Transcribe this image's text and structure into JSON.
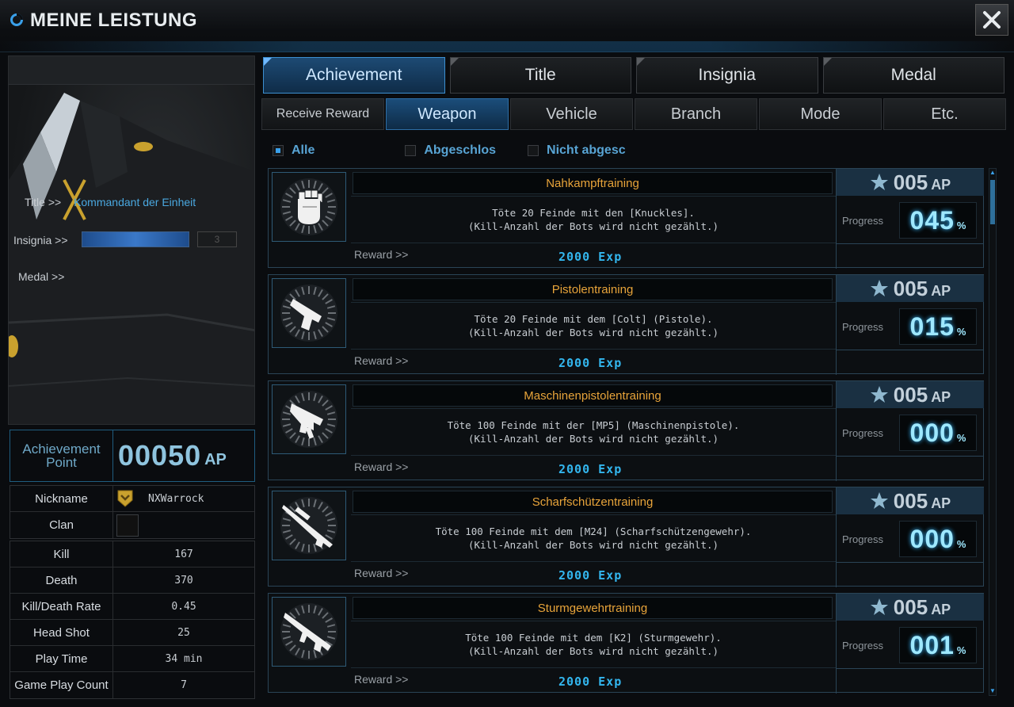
{
  "window": {
    "title": "MEINE LEISTUNG"
  },
  "profile": {
    "title_label": "Title >>",
    "title_value": "Kommandant der Einheit",
    "insignia_label": "Insignia >>",
    "insignia_count": "3",
    "medal_label": "Medal >>",
    "achievement_point_label_1": "Achievement",
    "achievement_point_label_2": "Point",
    "achievement_point_value": "00050",
    "achievement_point_unit": "AP",
    "nickname_label": "Nickname",
    "nickname": "NXWarrock",
    "clan_label": "Clan",
    "stats": [
      {
        "label": "Kill",
        "value": "167"
      },
      {
        "label": "Death",
        "value": "370"
      },
      {
        "label": "Kill/Death Rate",
        "value": "0.45"
      },
      {
        "label": "Head Shot",
        "value": "25"
      },
      {
        "label": "Play Time",
        "value": "34 min"
      },
      {
        "label": "Game Play Count",
        "value": "7"
      }
    ]
  },
  "tabs_main": [
    {
      "label": "Achievement",
      "active": true
    },
    {
      "label": "Title",
      "active": false
    },
    {
      "label": "Insignia",
      "active": false
    },
    {
      "label": "Medal",
      "active": false
    }
  ],
  "tabs_sub": [
    {
      "label": "Receive Reward",
      "active": false
    },
    {
      "label": "Weapon",
      "active": true
    },
    {
      "label": "Vehicle",
      "active": false
    },
    {
      "label": "Branch",
      "active": false
    },
    {
      "label": "Mode",
      "active": false
    },
    {
      "label": "Etc.",
      "active": false
    }
  ],
  "filters": [
    {
      "label": "Alle",
      "checked": true
    },
    {
      "label": "Abgeschlos",
      "checked": false
    },
    {
      "label": "Nicht abgesc",
      "checked": false
    }
  ],
  "labels": {
    "reward": "Reward >>",
    "progress": "Progress",
    "percent": "%",
    "ap_unit": "AP"
  },
  "achievements": [
    {
      "name": "Nahkampftraining",
      "line1": "Töte 20 Feinde mit den [Knuckles].",
      "line2": "(Kill-Anzahl der Bots wird nicht gezählt.)",
      "reward": "2000 Exp",
      "ap": "005",
      "progress": "045",
      "icon": "fist-icon"
    },
    {
      "name": "Pistolentraining",
      "line1": "Töte 20 Feinde mit dem [Colt] (Pistole).",
      "line2": "(Kill-Anzahl der Bots wird nicht gezählt.)",
      "reward": "2000 Exp",
      "ap": "005",
      "progress": "015",
      "icon": "pistol-icon"
    },
    {
      "name": "Maschinenpistolentraining",
      "line1": "Töte 100 Feinde mit der [MP5] (Maschinenpistole).",
      "line2": "(Kill-Anzahl der Bots wird nicht gezählt.)",
      "reward": "2000 Exp",
      "ap": "005",
      "progress": "000",
      "icon": "smg-icon"
    },
    {
      "name": "Scharfschützentraining",
      "line1": "Töte 100 Feinde mit dem [M24] (Scharfschützengewehr).",
      "line2": "(Kill-Anzahl der Bots wird nicht gezählt.)",
      "reward": "2000 Exp",
      "ap": "005",
      "progress": "000",
      "icon": "sniper-rifle-icon"
    },
    {
      "name": "Sturmgewehrtraining",
      "line1": "Töte 100 Feinde mit dem [K2] (Sturmgewehr).",
      "line2": "(Kill-Anzahl der Bots wird nicht gezählt.)",
      "reward": "2000 Exp",
      "ap": "005",
      "progress": "001",
      "icon": "assault-rifle-icon"
    }
  ]
}
